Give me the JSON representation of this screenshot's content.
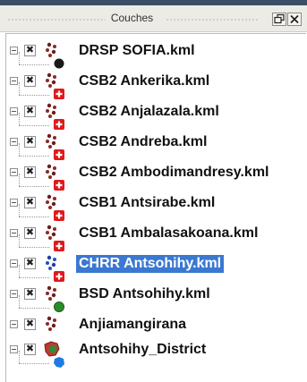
{
  "panel": {
    "title": "Couches"
  },
  "layers": [
    {
      "label": "DRSP SOFIA.kml",
      "checked": "✖",
      "icon": "dots-icon",
      "symbol": "black-circle-icon",
      "selected": false
    },
    {
      "label": "CSB2 Ankerika.kml",
      "checked": "✖",
      "icon": "dots-icon",
      "symbol": "red-cross-icon",
      "selected": false
    },
    {
      "label": "CSB2 Anjalazala.kml",
      "checked": "✖",
      "icon": "dots-icon",
      "symbol": "red-cross-icon",
      "selected": false
    },
    {
      "label": "CSB2 Andreba.kml",
      "checked": "✖",
      "icon": "dots-icon",
      "symbol": "red-cross-icon",
      "selected": false
    },
    {
      "label": "CSB2 Ambodimandresy.kml",
      "checked": "✖",
      "icon": "dots-icon",
      "symbol": "red-cross-icon",
      "selected": false
    },
    {
      "label": "CSB1 Antsirabe.kml",
      "checked": "✖",
      "icon": "dots-icon",
      "symbol": "red-cross-icon",
      "selected": false
    },
    {
      "label": "CSB1 Ambalasakoana.kml",
      "checked": "✖",
      "icon": "dots-icon",
      "symbol": "red-cross-icon",
      "selected": false
    },
    {
      "label": "CHRR Antsohihy.kml",
      "checked": "✖",
      "icon": "dots-icon",
      "symbol": "red-cross-icon",
      "selected": true
    },
    {
      "label": "BSD Antsohihy.kml",
      "checked": "✖",
      "icon": "dots-icon",
      "symbol": "green-circle-icon",
      "selected": false
    },
    {
      "label": "Anjiamangirana",
      "checked": "✖",
      "icon": "dots-icon",
      "symbol": "",
      "selected": false
    },
    {
      "label": "Antsohihy_District",
      "checked": "✖",
      "icon": "polygon-layer-icon",
      "symbol": "blue-polygon-icon",
      "selected": false
    }
  ],
  "colors": {
    "selection": "#3b78d1",
    "dots_dark": "#6b1e1e",
    "dots_selected": "#1f3fa0",
    "cross_red": "#e0191d",
    "symbol_black": "#1a1a1a",
    "symbol_green": "#2a8d2a",
    "symbol_blue": "#1d7be5"
  }
}
